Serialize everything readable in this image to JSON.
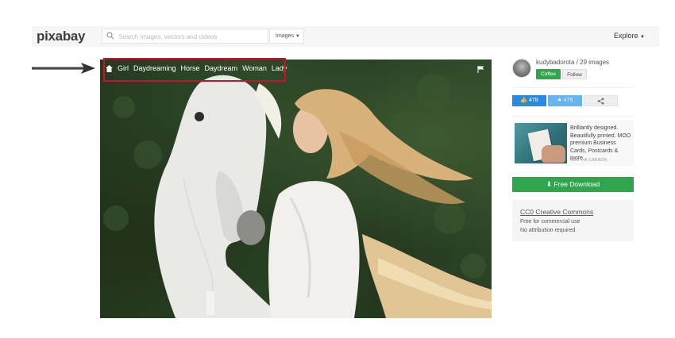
{
  "header": {
    "logo": "pixabay",
    "search_placeholder": "Search images, vectors and videos",
    "type_select": "Images",
    "explore": "Explore"
  },
  "image": {
    "tags": [
      "Girl",
      "Daydreaming",
      "Horse",
      "Daydream",
      "Woman",
      "Lady"
    ]
  },
  "sidebar": {
    "user": "kudybadorota / 29 images",
    "coffee_label": "Coffee",
    "follow_label": "Follow",
    "likes": "478",
    "favorites": "479",
    "ad": {
      "text": "Brilliantly designed. Beautifully printed. MOO premium Business Cards, Postcards & more.",
      "via": "ADS VIA CARBON"
    },
    "download_label": "Free Download",
    "license": {
      "link": "CC0 Creative Commons",
      "line1": "Free for commercial use",
      "line2": "No attribution required"
    }
  },
  "colors": {
    "green": "#2fa54e",
    "blue": "#2a8ae0",
    "light_blue": "#6ab4ee",
    "highlight_red": "#d0102a"
  }
}
